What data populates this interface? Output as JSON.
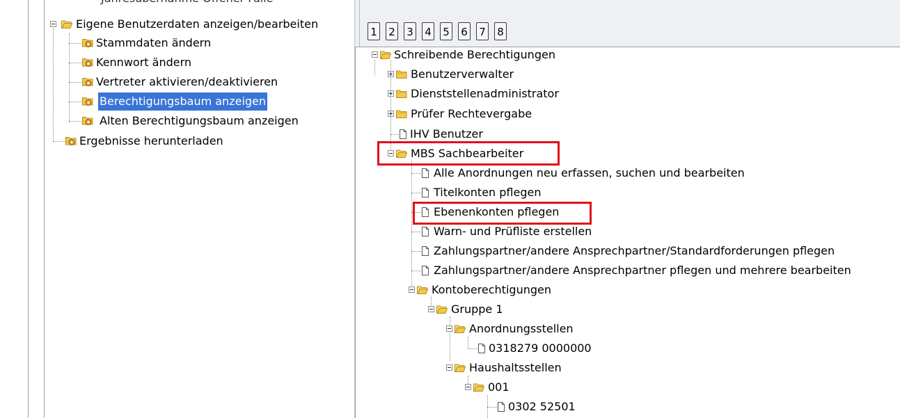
{
  "left_tree": {
    "cutoff_label": "Jahresübernahme Offener Fälle",
    "own_data": "Eigene Benutzerdaten anzeigen/bearbeiten",
    "master_data": "Stammdaten ändern",
    "password": "Kennwort ändern",
    "deputy": "Vertreter aktivieren/deaktivieren",
    "perm_tree": "Berechtigungsbaum anzeigen",
    "old_perm_tree": "Alten Berechtigungsbaum anzeigen",
    "download": "Ergebnisse herunterladen"
  },
  "tabs": [
    "1",
    "2",
    "3",
    "4",
    "5",
    "6",
    "7",
    "8"
  ],
  "right_tree": {
    "write_perms": "Schreibende Berechtigungen",
    "user_admin": "Benutzerverwalter",
    "office_admin": "Dienststellenadministrator",
    "auditor": "Prüfer Rechtevergabe",
    "ihv_user": "IHV Benutzer",
    "mbs": "MBS Sachbearbeiter",
    "all_orders": "Alle Anordnungen neu erfassen, suchen und bearbeiten",
    "title_accounts": "Titelkonten pflegen",
    "level_accounts": "Ebenenkonten pflegen",
    "warn_list": "Warn- und Prüfliste erstellen",
    "partners_std": "Zahlungspartner/andere Ansprechpartner/Standardforderungen pflegen",
    "partners_multi": "Zahlungspartner/andere Ansprechpartner pflegen und mehrere bearbeiten",
    "account_perms": "Kontoberechtigungen",
    "group1": "Gruppe 1",
    "order_offices": "Anordnungsstellen",
    "order_office_1": "0318279 0000000",
    "budget_offices": "Haushaltsstellen",
    "b001": "001",
    "b001_item": "0302 52501"
  },
  "colors": {
    "selection": "#3875d7",
    "highlight_box": "#e0101a",
    "folder": "#f2c94c",
    "gear": "#e2a23b"
  }
}
